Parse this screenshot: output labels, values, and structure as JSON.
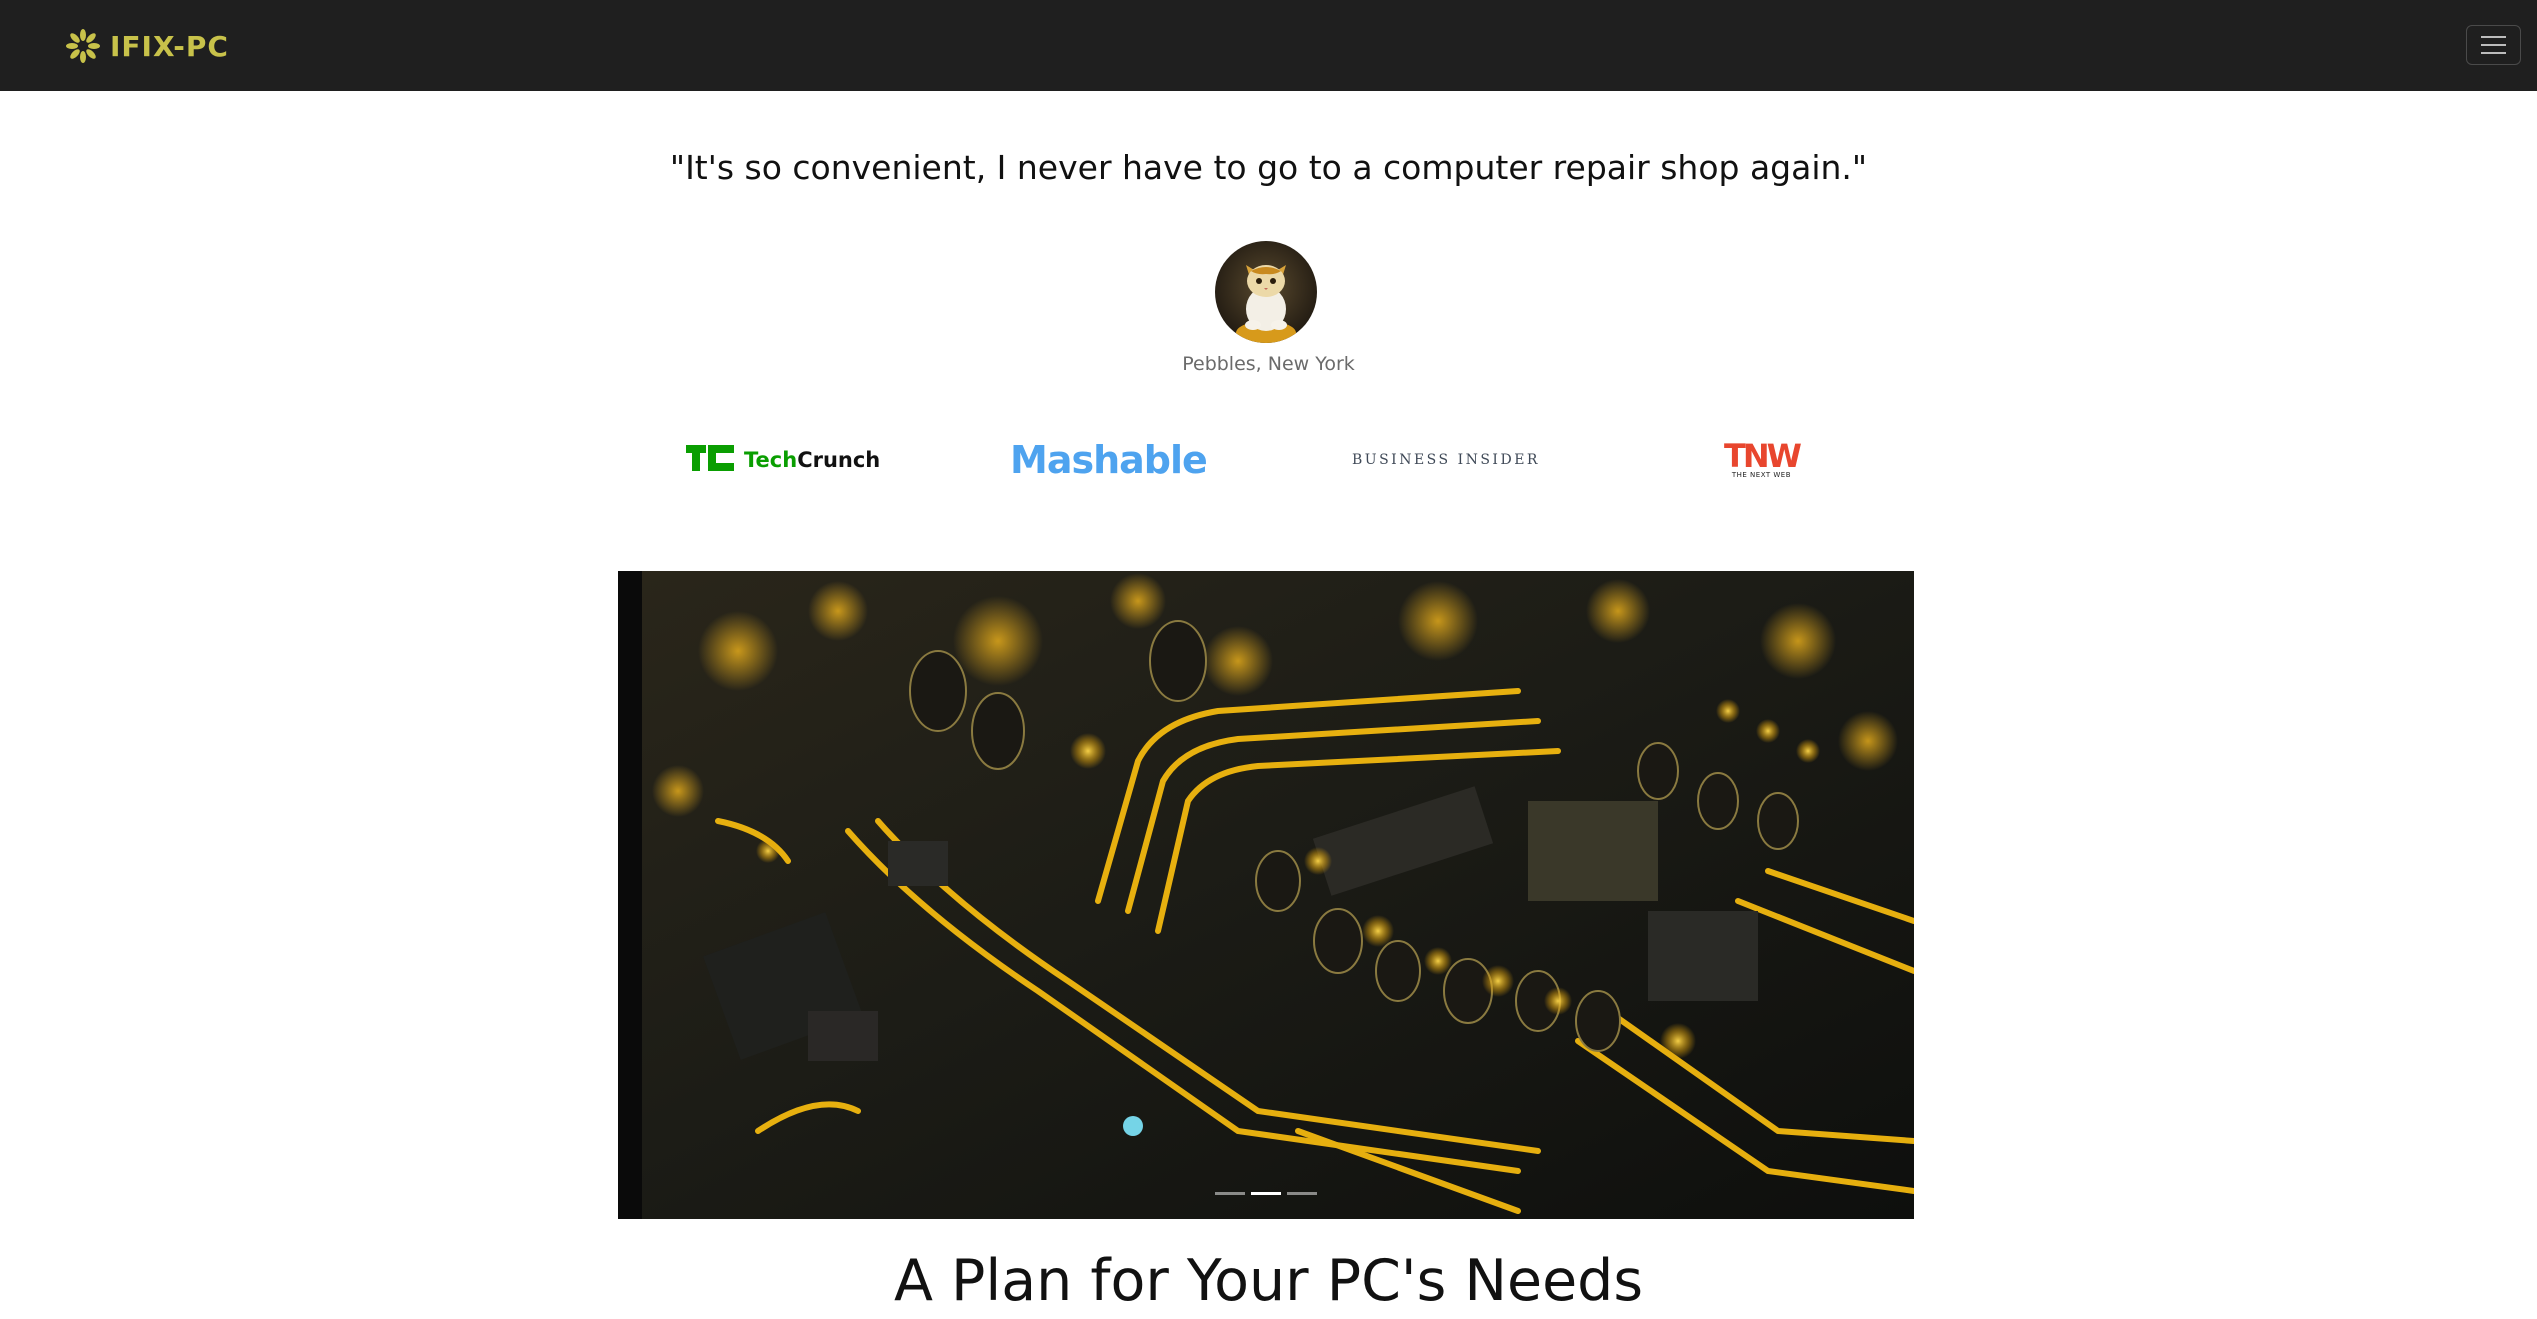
{
  "navbar": {
    "brand_name": "IFIX-PC",
    "brand_icon": "gear-flower-icon",
    "brand_color": "#c8c24a",
    "background": "#1f1f1f",
    "menu_icon": "hamburger-icon"
  },
  "testimonial": {
    "quote": "\"It's so convenient, I never have to go to a computer repair shop again.\"",
    "author": "Pebbles, New York",
    "avatar": "cat-avatar"
  },
  "press_logos": {
    "techcrunch": {
      "prefix": "Tech",
      "suffix": "Crunch",
      "color": "#0a9e01"
    },
    "mashable": {
      "text": "Mashable",
      "color": "#4ea3ef"
    },
    "business_insider": {
      "text": "BUSINESS INSIDER",
      "color": "#3f4957"
    },
    "tnw": {
      "text": "TNW",
      "subtext": "THE NEXT WEB",
      "color": "#e8462e"
    }
  },
  "carousel": {
    "image": "circuit-board-image",
    "slide_count": 3,
    "active_slide": 2
  },
  "section": {
    "title": "A Plan for Your PC's Needs"
  }
}
